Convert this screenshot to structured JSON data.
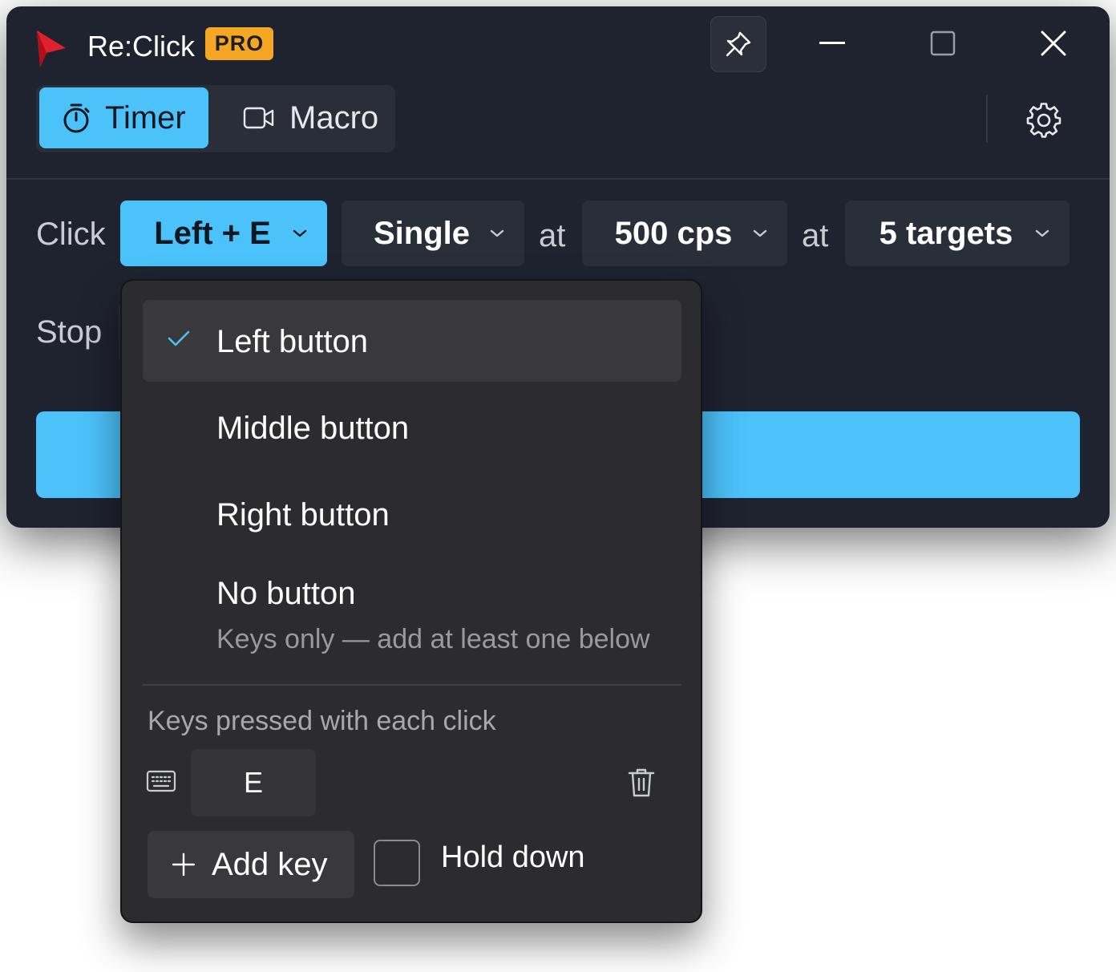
{
  "app": {
    "title": "Re:Click",
    "badge": "PRO",
    "brand_color": "#e0202e",
    "accent": "#4cc2fb"
  },
  "titlebar": {
    "icons": [
      "pin-icon",
      "minimize-icon",
      "maximize-icon",
      "close-icon"
    ]
  },
  "tabs": [
    {
      "label": "Timer",
      "icon": "stopwatch-icon",
      "active": true
    },
    {
      "label": "Macro",
      "icon": "video-camera-icon",
      "active": false
    }
  ],
  "settings": {
    "icon": "gear-icon"
  },
  "click_row": {
    "label": "Click",
    "button_mode": "Left + E",
    "click_type": "Single",
    "at1": "at",
    "rate": "500 cps",
    "at2": "at",
    "targets": "5 targets"
  },
  "stop_row": {
    "label": "Stop"
  },
  "dropdown": {
    "items": [
      {
        "label": "Left button",
        "selected": true
      },
      {
        "label": "Middle button",
        "selected": false
      },
      {
        "label": "Right button",
        "selected": false
      },
      {
        "label": "No button",
        "sublabel": "Keys only — add at least one below",
        "selected": false
      }
    ],
    "keys_section": {
      "title": "Keys pressed with each click",
      "keys": [
        "E"
      ],
      "add_key_label": "Add key",
      "hold_down_label": "Hold down",
      "hold_down_checked": false
    }
  }
}
